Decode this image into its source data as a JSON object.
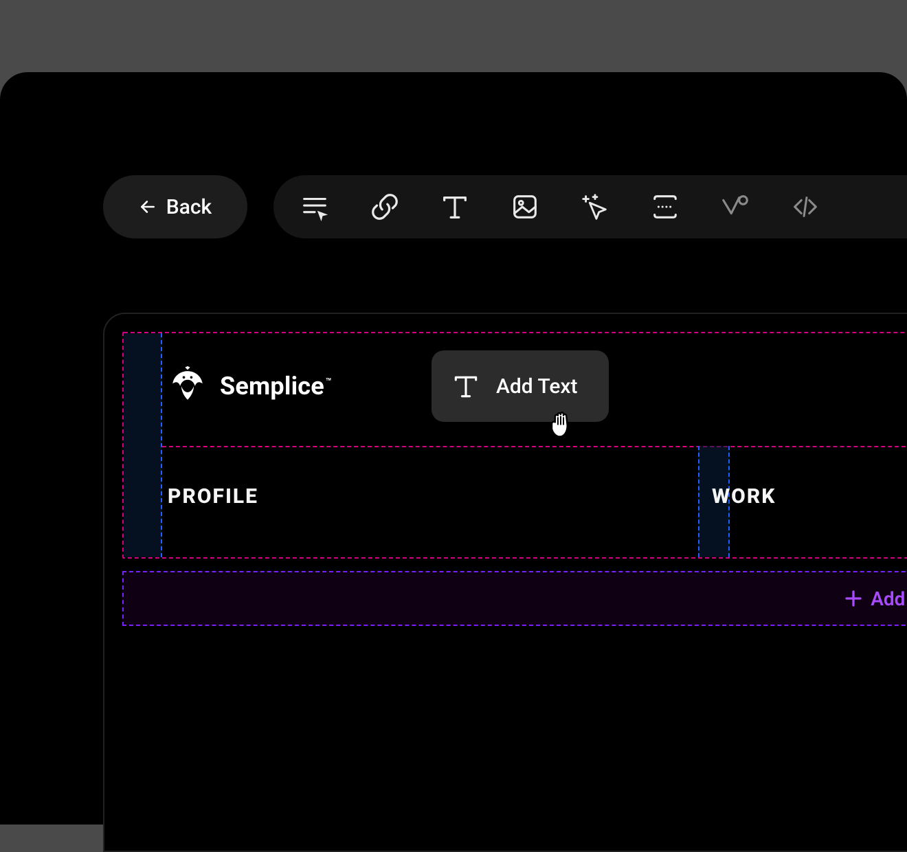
{
  "back_button": {
    "label": "Back"
  },
  "toolbar": {
    "tools": [
      {
        "name": "list-cursor-icon"
      },
      {
        "name": "link-icon"
      },
      {
        "name": "text-icon"
      },
      {
        "name": "image-icon"
      },
      {
        "name": "cursor-sparkle-icon"
      },
      {
        "name": "spacer-icon"
      },
      {
        "name": "branch-icon"
      },
      {
        "name": "code-icon"
      }
    ]
  },
  "logo": {
    "brand": "Semplice",
    "trademark": "™"
  },
  "nav": {
    "items": [
      {
        "label": "PROFILE"
      },
      {
        "label": "WORK"
      }
    ]
  },
  "popup": {
    "label": "Add Text"
  },
  "add_row": {
    "label": "Add Ro"
  }
}
